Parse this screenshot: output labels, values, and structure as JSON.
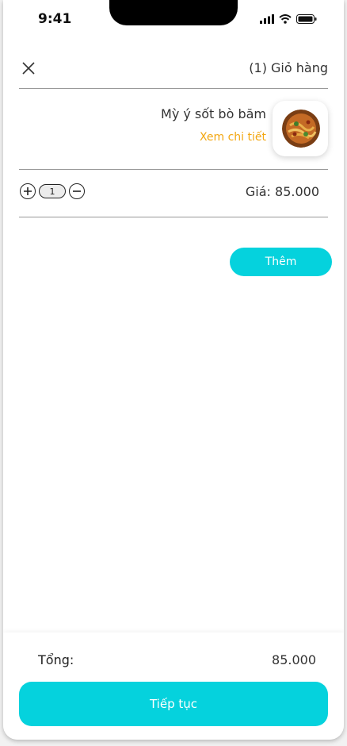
{
  "status_bar": {
    "time": "9:41",
    "icons": [
      "signal-icon",
      "wifi-icon",
      "battery-icon"
    ]
  },
  "header": {
    "close_icon": "close-icon",
    "title": "(1) Giỏ hàng"
  },
  "cart_item": {
    "name": "Mỳ ý sốt bò băm",
    "detail_link": "Xem chi tiết",
    "image": "pasta-dish-image",
    "quantity": "1",
    "increase_icon": "plus-circle-icon",
    "decrease_icon": "minus-circle-icon",
    "price": "Giá: 85.000"
  },
  "add_button": {
    "label": "Thêm"
  },
  "footer": {
    "total_label": "Tổng:",
    "total_value": "85.000",
    "continue_label": "Tiếp tục"
  },
  "colors": {
    "accent": "#05d2dd",
    "link": "#f3a712",
    "text": "#333333"
  }
}
